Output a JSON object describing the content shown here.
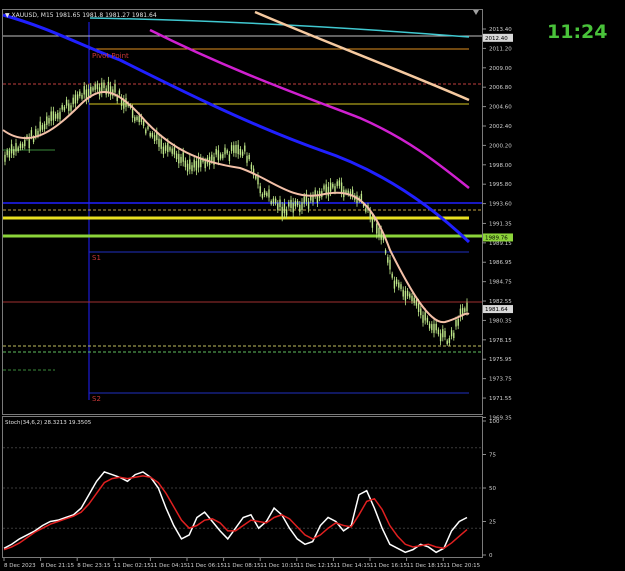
{
  "window": {
    "title": "XAUUSD,M15",
    "ohlc_text": "▼ XAUUSD, M15  1981.65 1981.8 1981.27 1981.64",
    "clock": "11:24"
  },
  "overlays": {
    "pivot_label": "Pivot Point",
    "s1_label": "S1",
    "s2_label": "S2",
    "stoch_header": "Stoch(34,6,2) 28.3213 19.3505"
  },
  "price_axis": {
    "ticks": [
      "2013.40",
      "2011.20",
      "2009.00",
      "2006.80",
      "2004.60",
      "2002.40",
      "2000.20",
      "1998.00",
      "1995.80",
      "1993.60",
      "1991.35",
      "1989.15",
      "1986.95",
      "1984.75",
      "1982.55",
      "1980.35",
      "1978.15",
      "1975.95",
      "1973.75",
      "1971.55",
      "1969.35"
    ],
    "tags": [
      {
        "text": "2012.40",
        "color": "#d8d8d8",
        "value": 2012.4
      },
      {
        "text": "1989.76",
        "color": "#8cd43a",
        "value": 1989.76
      },
      {
        "text": "1981.64",
        "color": "#d8d8d8",
        "value": 1981.64
      }
    ]
  },
  "stoch_axis": {
    "ticks": [
      "100",
      "75",
      "50",
      "25",
      "0"
    ]
  },
  "time_axis": {
    "ticks": [
      "8 Dec 2023",
      "8 Dec 21:15",
      "8 Dec 23:15",
      "11 Dec 02:15",
      "11 Dec 04:15",
      "11 Dec 06:15",
      "11 Dec 08:15",
      "11 Dec 10:15",
      "11 Dec 12:15",
      "11 Dec 14:15",
      "11 Dec 16:15",
      "11 Dec 18:15",
      "11 Dec 20:15"
    ]
  },
  "colors": {
    "background": "#000000",
    "candle": "#bfe88a",
    "slow_ma": "#2020ff",
    "magenta_ma": "#d020d0",
    "peach_ma": "#f5c9a0",
    "short_ma": "#f3c0a8",
    "cyan_line": "#40c8d0",
    "green_level": "#8cd43a",
    "yellow_level": "#e8e020",
    "stoch_main": "#ffffff",
    "stoch_signal": "#e02020"
  }
}
